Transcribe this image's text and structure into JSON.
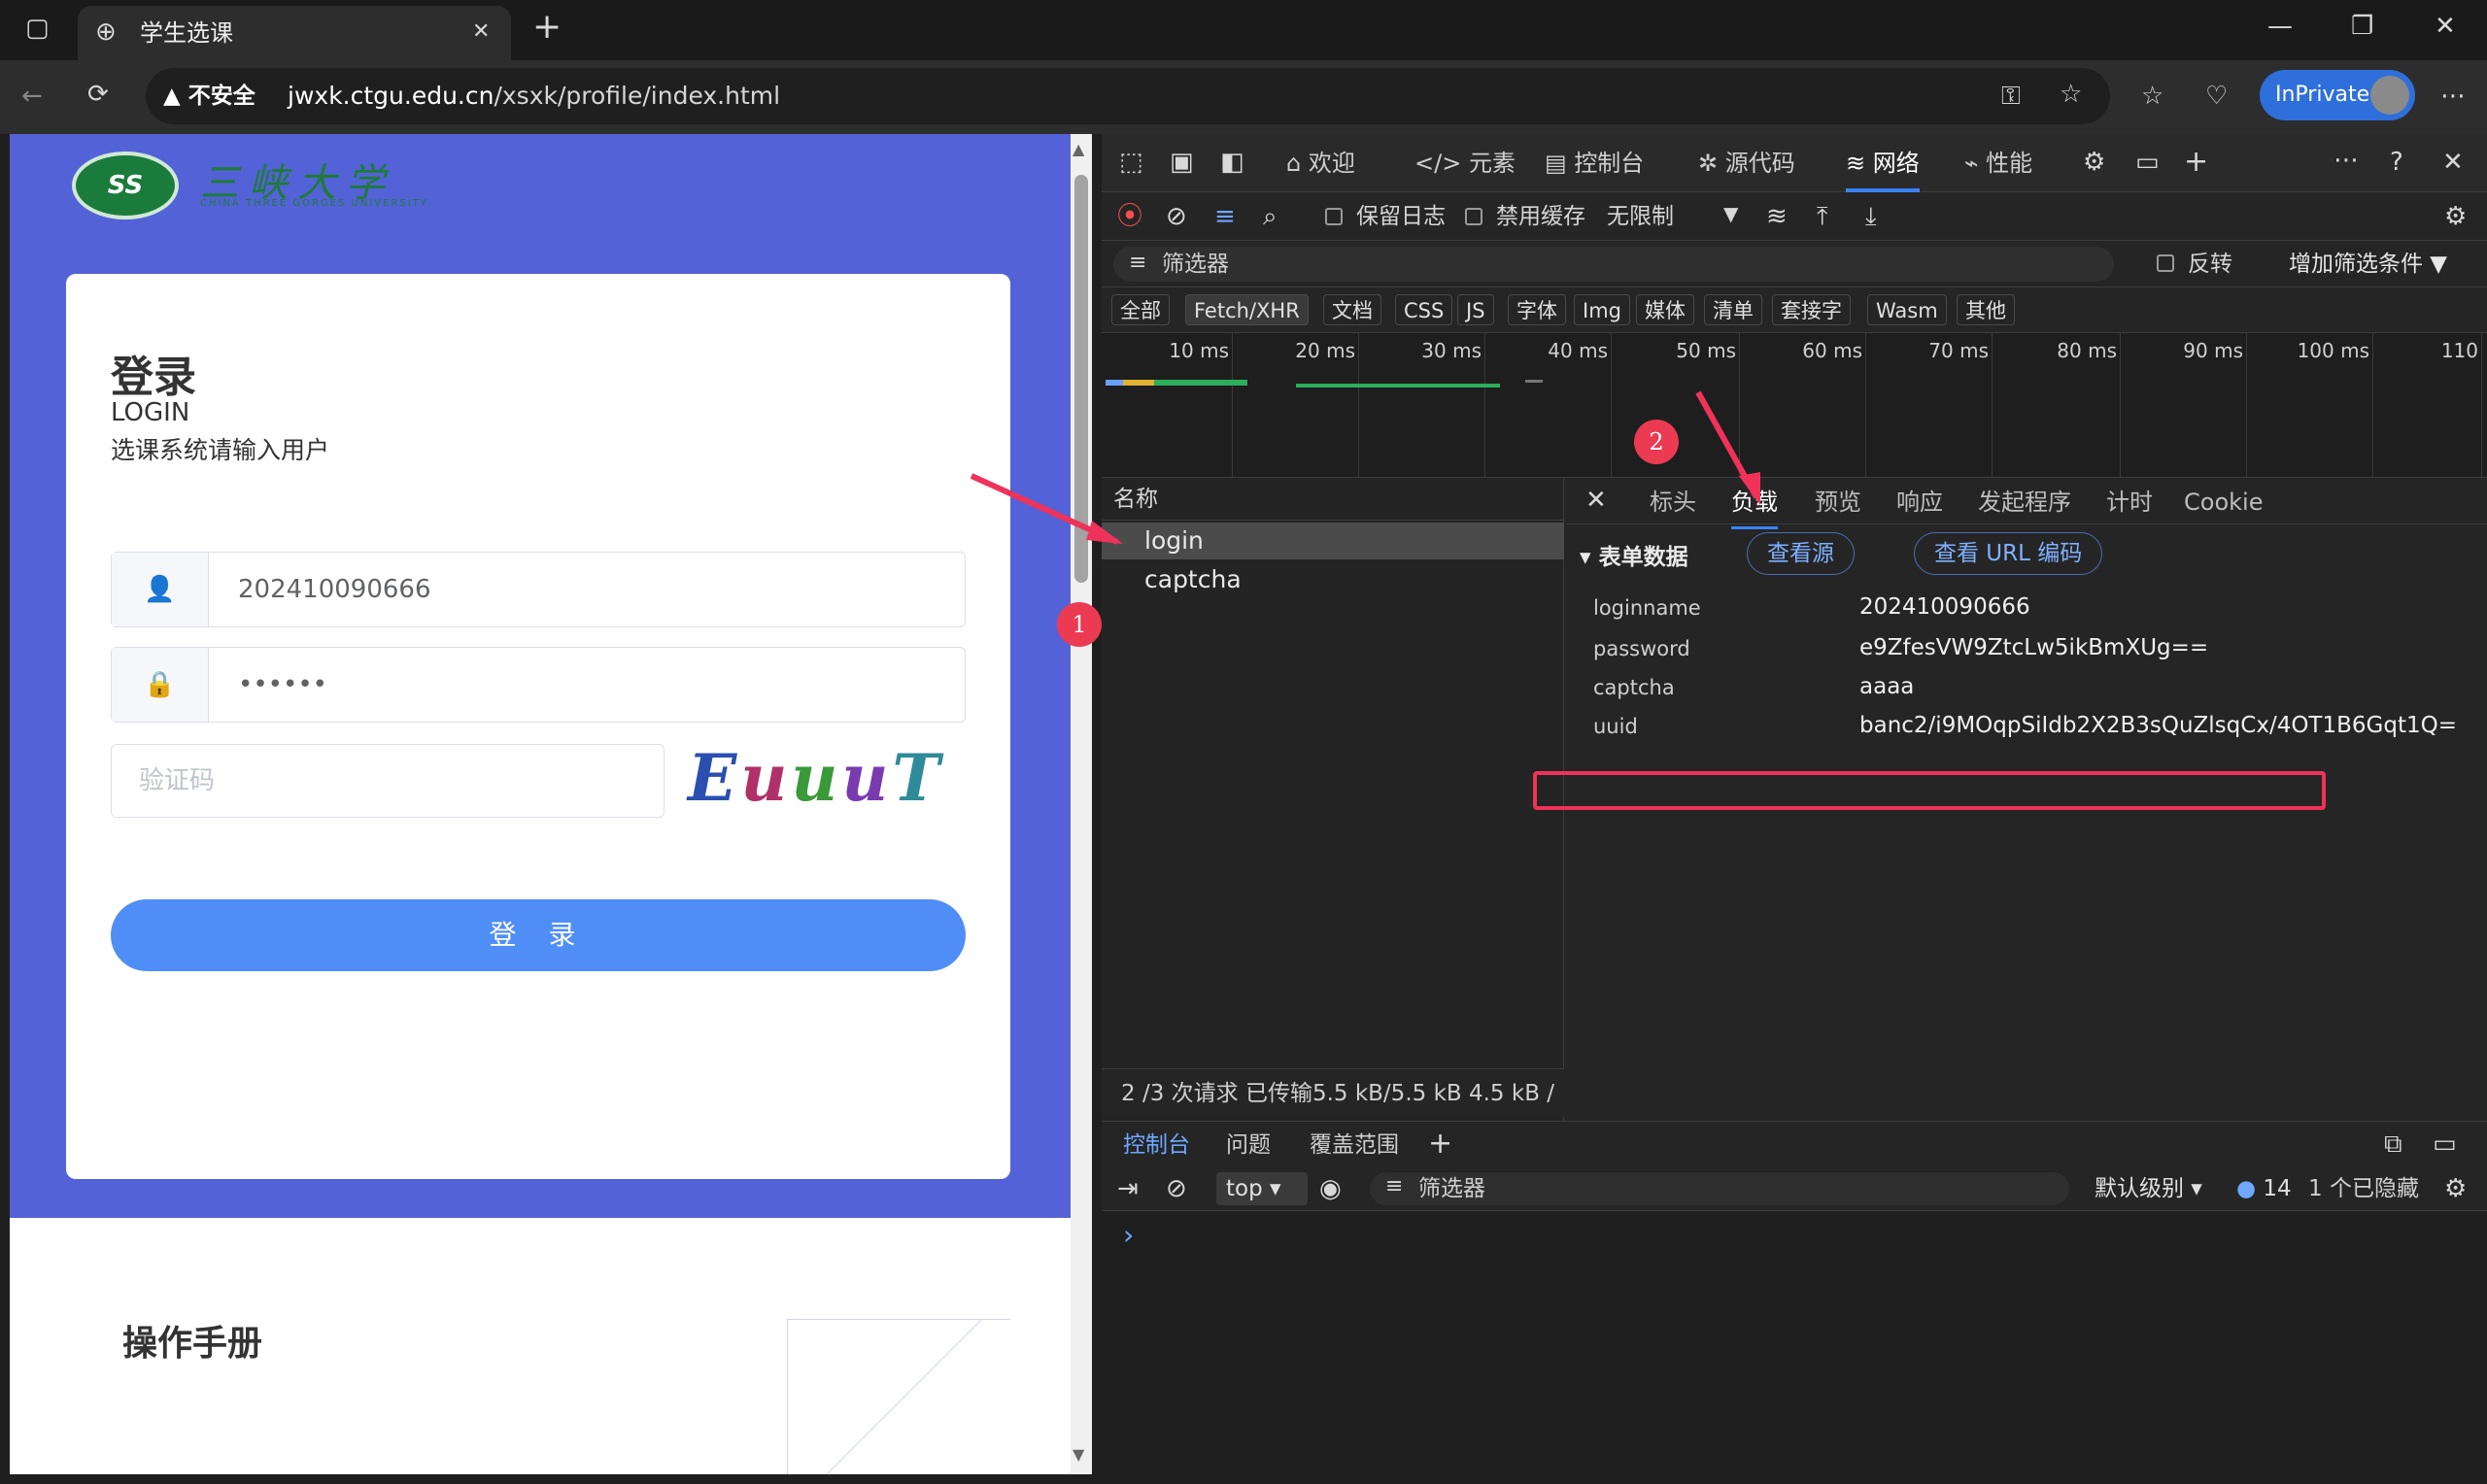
{
  "browser": {
    "tab_title": "学生选课",
    "close_tab": "✕",
    "new_tab": "+",
    "not_secure": "不安全",
    "url_host": "jwxk.ctgu.edu.cn",
    "url_path": "/xsxk/profile/index.html",
    "inprivate": "InPrivate"
  },
  "page": {
    "logo_cn": "三峡大学",
    "logo_en": "CHINA THREE GORGES UNIVERSITY",
    "logo_mark": "SS",
    "login_title": "登录",
    "login_sub": "LOGIN",
    "login_hint": "选课系统请输入用户",
    "username_value": "202410090666",
    "password_value": "••••••",
    "captcha_placeholder": "验证码",
    "captcha_text": "EuuuT",
    "login_button": "登 录",
    "manual_title": "操作手册"
  },
  "devtools": {
    "tabs": [
      "欢迎",
      "元素",
      "控制台",
      "源代码",
      "网络",
      "性能"
    ],
    "active_tab": "网络",
    "preserve_log": "保留日志",
    "disable_cache": "禁用缓存",
    "throttle": "无限制",
    "filter_placeholder": "筛选器",
    "invert": "反转",
    "more_filters": "增加筛选条件",
    "type_filters": [
      "全部",
      "Fetch/XHR",
      "文档",
      "CSS",
      "JS",
      "字体",
      "Img",
      "媒体",
      "清单",
      "套接字",
      "Wasm",
      "其他"
    ],
    "timeline_ticks": [
      "10 ms",
      "20 ms",
      "30 ms",
      "40 ms",
      "50 ms",
      "60 ms",
      "70 ms",
      "80 ms",
      "90 ms",
      "100 ms",
      "110"
    ],
    "name_header": "名称",
    "requests": [
      "login",
      "captcha"
    ],
    "summary": "2 /3 次请求   已传输5.5 kB/5.5 kB   4.5 kB /",
    "detail_tabs": [
      "标头",
      "负载",
      "预览",
      "响应",
      "发起程序",
      "计时",
      "Cookie"
    ],
    "active_detail_tab": "负载",
    "form_data_title": "表单数据",
    "view_source": "查看源",
    "view_url_encoded": "查看 URL 编码",
    "form_fields": [
      {
        "key": "loginname",
        "value": "202410090666"
      },
      {
        "key": "password",
        "value": "e9ZfesVW9ZtcLw5ikBmXUg=="
      },
      {
        "key": "captcha",
        "value": "aaaa"
      },
      {
        "key": "uuid",
        "value": "banc2/i9MOqpSiIdb2X2B3sQuZlsqCx/4OT1B6Gqt1Q="
      }
    ],
    "drawer_tabs": [
      "控制台",
      "问题",
      "覆盖范围"
    ],
    "console_context": "top",
    "console_filter": "筛选器",
    "log_level": "默认级别",
    "message_count": "14",
    "hidden_count": "1 个已隐藏",
    "prompt": "›"
  },
  "annotations": {
    "badge1": "1",
    "badge2": "2"
  },
  "colors": {
    "hero": "#5362d6",
    "button": "#4f8ef7",
    "accent": "#3b82f6",
    "highlight": "#f0325a"
  }
}
